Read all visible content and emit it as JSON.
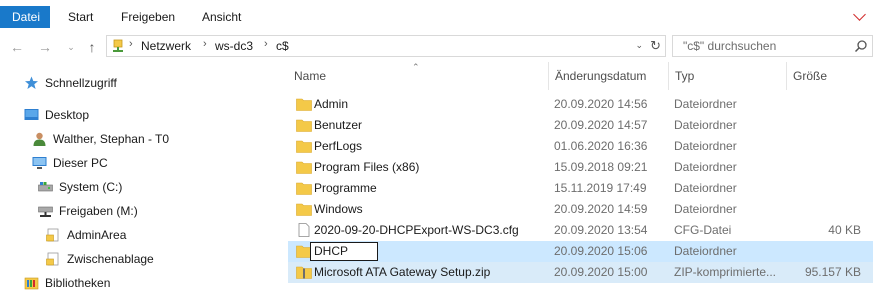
{
  "ribbon": {
    "tabs": [
      "Datei",
      "Start",
      "Freigeben",
      "Ansicht"
    ]
  },
  "address": {
    "crumbs": [
      "Netzwerk",
      "ws-dc3",
      "c$"
    ]
  },
  "search": {
    "placeholder": "\"c$\" durchsuchen"
  },
  "navpane": {
    "items": [
      {
        "label": "Schnellzugriff",
        "icon": "star-icon"
      },
      {
        "label": "Desktop",
        "icon": "desktop-icon"
      },
      {
        "label": "Walther, Stephan - T0",
        "icon": "user-icon"
      },
      {
        "label": "Dieser PC",
        "icon": "computer-icon"
      },
      {
        "label": "System (C:)",
        "icon": "drive-icon"
      },
      {
        "label": "Freigaben (M:)",
        "icon": "network-drive-icon"
      },
      {
        "label": "AdminArea",
        "icon": "shared-folder-icon"
      },
      {
        "label": "Zwischenablage",
        "icon": "shared-folder-icon"
      },
      {
        "label": "Bibliotheken",
        "icon": "library-icon"
      }
    ]
  },
  "columns": {
    "name": "Name",
    "date": "Änderungsdatum",
    "type": "Typ",
    "size": "Größe"
  },
  "files": [
    {
      "name": "Admin",
      "date": "20.09.2020 14:56",
      "type": "Dateiordner",
      "size": "",
      "icon": "folder-icon"
    },
    {
      "name": "Benutzer",
      "date": "20.09.2020 14:57",
      "type": "Dateiordner",
      "size": "",
      "icon": "folder-icon"
    },
    {
      "name": "PerfLogs",
      "date": "01.06.2020 16:36",
      "type": "Dateiordner",
      "size": "",
      "icon": "folder-icon"
    },
    {
      "name": "Program Files (x86)",
      "date": "15.09.2018 09:21",
      "type": "Dateiordner",
      "size": "",
      "icon": "folder-icon"
    },
    {
      "name": "Programme",
      "date": "15.11.2019 17:49",
      "type": "Dateiordner",
      "size": "",
      "icon": "folder-icon"
    },
    {
      "name": "Windows",
      "date": "20.09.2020 14:59",
      "type": "Dateiordner",
      "size": "",
      "icon": "folder-icon"
    },
    {
      "name": "2020-09-20-DHCPExport-WS-DC3.cfg",
      "date": "20.09.2020 13:54",
      "type": "CFG-Datei",
      "size": "40 KB",
      "icon": "file-icon"
    },
    {
      "name": "DHCP",
      "date": "20.09.2020 15:06",
      "type": "Dateiordner",
      "size": "",
      "icon": "folder-icon"
    },
    {
      "name": "Microsoft ATA Gateway Setup.zip",
      "date": "20.09.2020 15:00",
      "type": "ZIP-komprimierte...",
      "size": "95.157 KB",
      "icon": "zip-icon"
    }
  ],
  "colors": {
    "accent": "#1979ca",
    "selection": "#cce8ff",
    "folder": "#f4c948"
  }
}
